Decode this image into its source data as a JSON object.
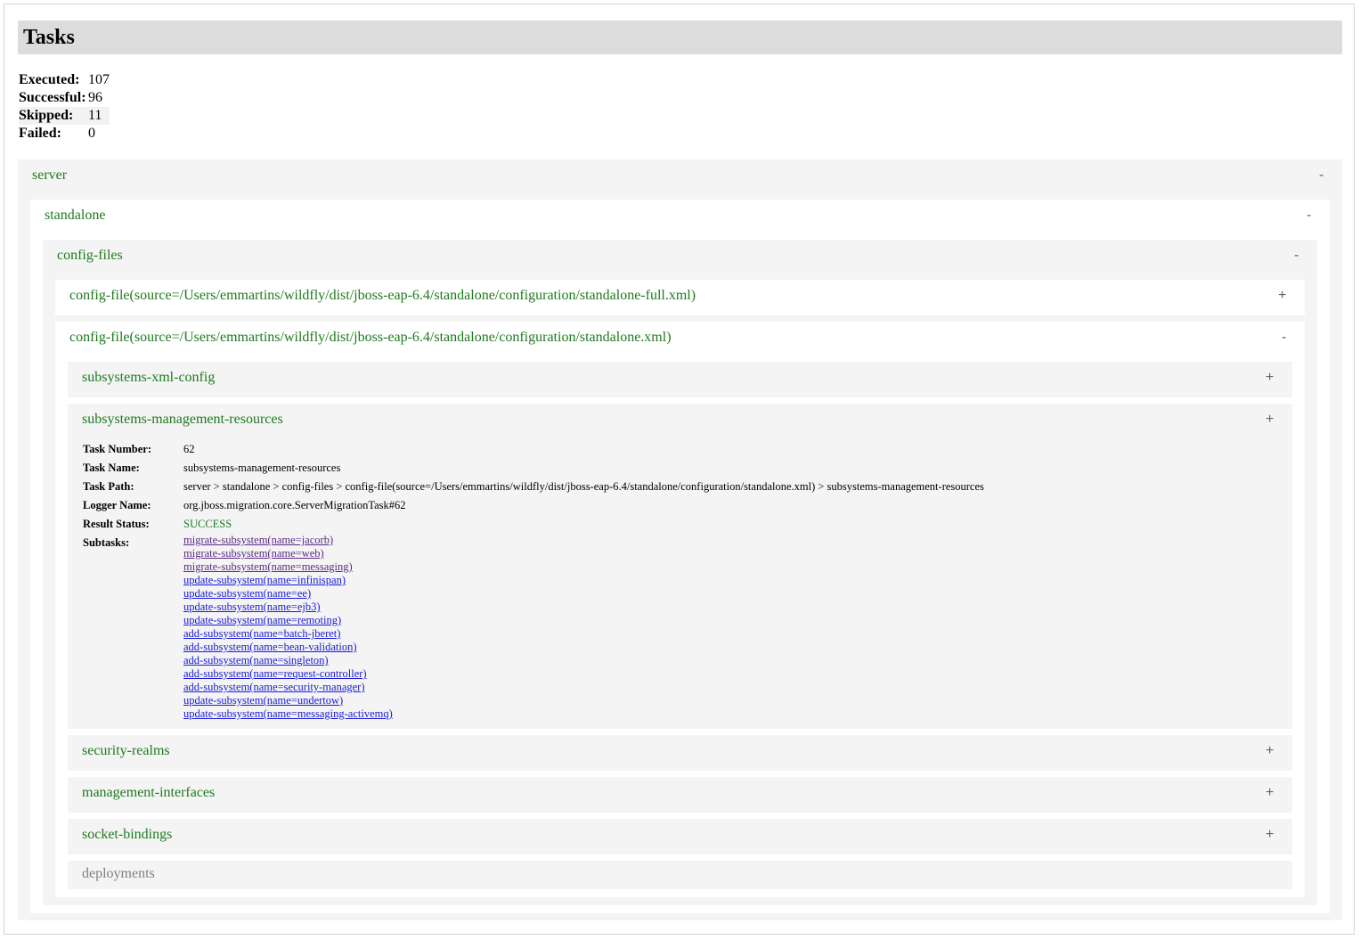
{
  "page": {
    "title": "Tasks"
  },
  "summary": [
    {
      "label": "Executed:",
      "value": "107"
    },
    {
      "label": "Successful:",
      "value": "96"
    },
    {
      "label": "Skipped:",
      "value": "11"
    },
    {
      "label": "Failed:",
      "value": "0"
    }
  ],
  "tree": {
    "server": {
      "label": "server",
      "toggle": "-"
    },
    "standalone": {
      "label": "standalone",
      "toggle": "-"
    },
    "config_files": {
      "label": "config-files",
      "toggle": "-"
    },
    "config_full": {
      "label": "config-file(source=/Users/emmartins/wildfly/dist/jboss-eap-6.4/standalone/configuration/standalone-full.xml)",
      "toggle": "+"
    },
    "config_standalone": {
      "label": "config-file(source=/Users/emmartins/wildfly/dist/jboss-eap-6.4/standalone/configuration/standalone.xml)",
      "toggle": "-"
    },
    "subsystems_xml": {
      "label": "subsystems-xml-config",
      "toggle": "+"
    },
    "subsystems_mgmt": {
      "label": "subsystems-management-resources",
      "toggle": "+"
    },
    "security_realms": {
      "label": "security-realms",
      "toggle": "+"
    },
    "management_interfaces": {
      "label": "management-interfaces",
      "toggle": "+"
    },
    "socket_bindings": {
      "label": "socket-bindings",
      "toggle": "+"
    },
    "deployments": {
      "label": "deployments"
    }
  },
  "details": {
    "task_number": {
      "key": "Task Number:",
      "value": "62"
    },
    "task_name": {
      "key": "Task Name:",
      "value": "subsystems-management-resources"
    },
    "task_path": {
      "key": "Task Path:",
      "value": "server > standalone > config-files > config-file(source=/Users/emmartins/wildfly/dist/jboss-eap-6.4/standalone/configuration/standalone.xml) > subsystems-management-resources"
    },
    "logger_name": {
      "key": "Logger Name:",
      "value": "org.jboss.migration.core.ServerMigrationTask#62"
    },
    "result_status": {
      "key": "Result Status:",
      "value": "SUCCESS"
    },
    "subtasks_label": "Subtasks:",
    "subtasks": [
      "migrate-subsystem(name=jacorb)",
      "migrate-subsystem(name=web)",
      "migrate-subsystem(name=messaging)",
      "update-subsystem(name=infinispan)",
      "update-subsystem(name=ee)",
      "update-subsystem(name=ejb3)",
      "update-subsystem(name=remoting)",
      "add-subsystem(name=batch-jberet)",
      "add-subsystem(name=bean-validation)",
      "add-subsystem(name=singleton)",
      "add-subsystem(name=request-controller)",
      "add-subsystem(name=security-manager)",
      "update-subsystem(name=undertow)",
      "update-subsystem(name=messaging-activemq)"
    ]
  },
  "colors": {
    "title_green": "#1e7a1e",
    "link_blue": "#1a1adb",
    "visited_purple": "#5b2a86",
    "panel_grey": "#f4f4f4",
    "header_grey": "#dcdcdc"
  }
}
